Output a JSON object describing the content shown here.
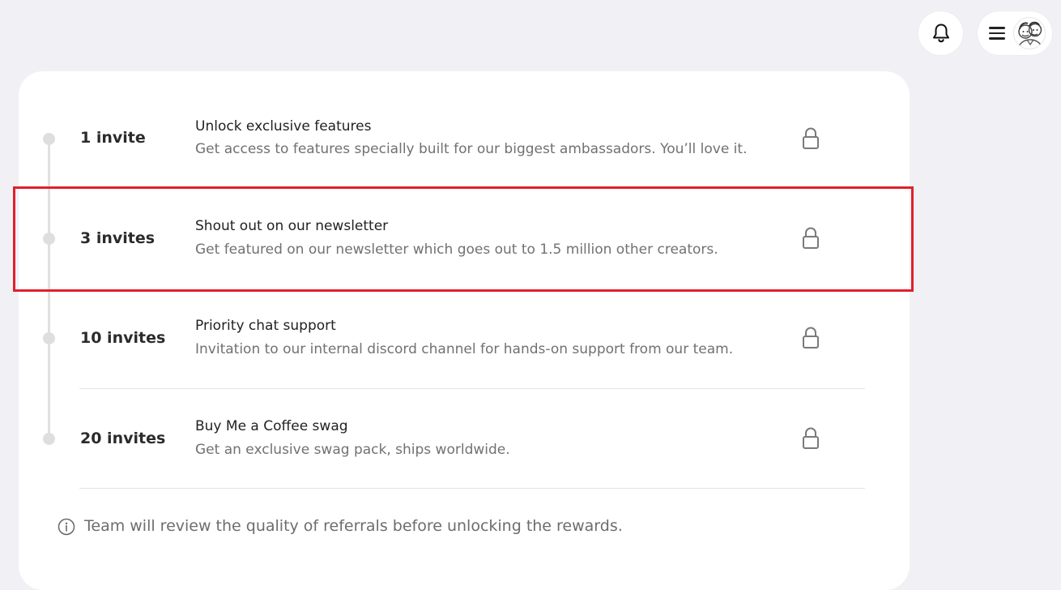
{
  "header": {
    "notifications_icon": "bell-icon",
    "menu_icon": "hamburger-menu-icon",
    "avatar": "avatar-image"
  },
  "rewards": [
    {
      "count": "1 invite",
      "title": "Unlock exclusive features",
      "description": "Get access to features specially built for our biggest ambassadors. You’ll love it.",
      "icon": "lock-icon"
    },
    {
      "count": "3 invites",
      "title": "Shout out on our newsletter",
      "description": "Get featured on our newsletter which goes out to 1.5 million other creators.",
      "icon": "lock-icon"
    },
    {
      "count": "10 invites",
      "title": "Priority chat support",
      "description": "Invitation to our internal discord channel for hands-on support from our team.",
      "icon": "lock-icon"
    },
    {
      "count": "20 invites",
      "title": "Buy Me a Coffee swag",
      "description": "Get an exclusive swag pack, ships worldwide.",
      "icon": "lock-icon"
    }
  ],
  "note": {
    "icon": "info-icon",
    "text": "Team will review the quality of referrals before unlocking the rewards."
  },
  "colors": {
    "background": "#f1f1f5",
    "highlight": "#e0202c",
    "timeline": "#e0e0e0"
  }
}
